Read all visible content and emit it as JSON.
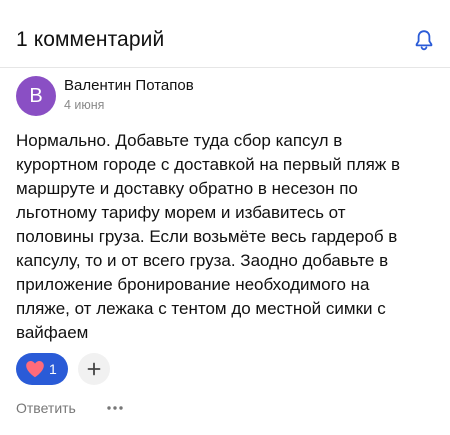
{
  "header": {
    "title": "1 комментарий",
    "bell_icon": "bell-icon"
  },
  "comment": {
    "author": {
      "name": "Валентин Потапов",
      "initial": "В",
      "avatar_color": "#8a4fc4"
    },
    "date": "4 июня",
    "text": "Нормально. Добавьте туда сбор капсул в курортном городе с доставкой на первый пляж в маршруте и доставку обратно в несезон по льготному тарифу морем и избавитесь от половины груза. Если возьмёте весь гардероб в капсулу, то и от всего груза. Заодно добавьте в приложение бронирование необходимого на пляже, от лежака с тентом до местной симки с вайфаем",
    "reactions": [
      {
        "icon": "heart-icon",
        "count": "1",
        "active": true
      }
    ],
    "add_reaction_icon": "plus-icon",
    "reply_label": "Ответить",
    "more_icon": "more-horizontal-icon"
  },
  "colors": {
    "accent": "#2a5bd7",
    "heart": "#ff6b7a",
    "muted_text": "#8a8a8a"
  }
}
